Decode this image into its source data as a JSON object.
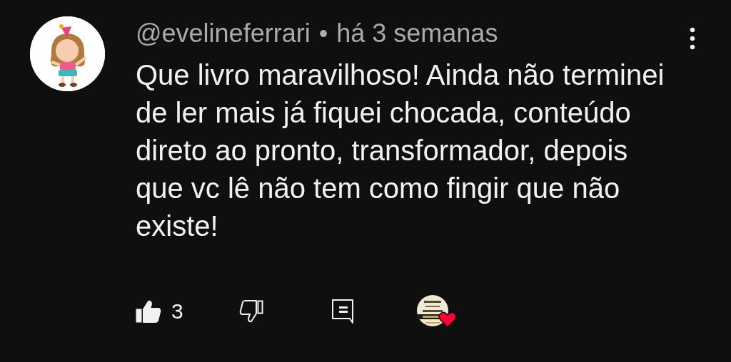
{
  "comment": {
    "author": "@evelineferrari",
    "separator": "•",
    "time": "há 3 semanas",
    "text": "Que livro maravilhoso! Ainda não terminei de ler mais já fiquei chocada, conteúdo direto ao pronto, transformador, depois que vc lê não tem como fingir que não existe!",
    "likes": {
      "count": "3",
      "liked": true
    },
    "disliked": false,
    "creator_heart": true
  }
}
